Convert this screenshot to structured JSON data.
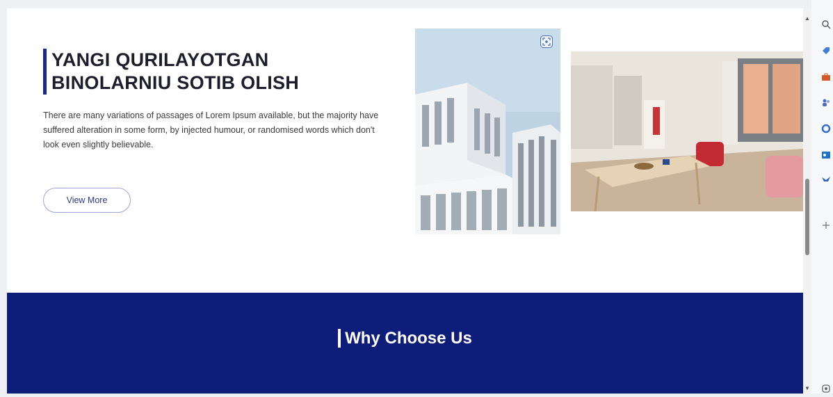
{
  "hero": {
    "title": "YANGI QURILAYOTGAN BINOLARNIU SOTIB OLISH",
    "description": "There are many variations of passages of Lorem Ipsum available, but the majority have suffered alteration in some form, by injected humour, or randomised words which don't look even slightly believable.",
    "button_label": "View More"
  },
  "why_section": {
    "title": "Why Choose Us"
  },
  "icons": {
    "image_focus": "focus-frame-icon",
    "sidebar": [
      "search-icon",
      "tag-icon",
      "briefcase-icon",
      "people-icon",
      "circle-icon",
      "outlook-icon",
      "bird-icon",
      "plus-icon",
      "settings-icon"
    ]
  },
  "colors": {
    "accent": "#142a8c",
    "section_bg": "#0f1d7a"
  }
}
